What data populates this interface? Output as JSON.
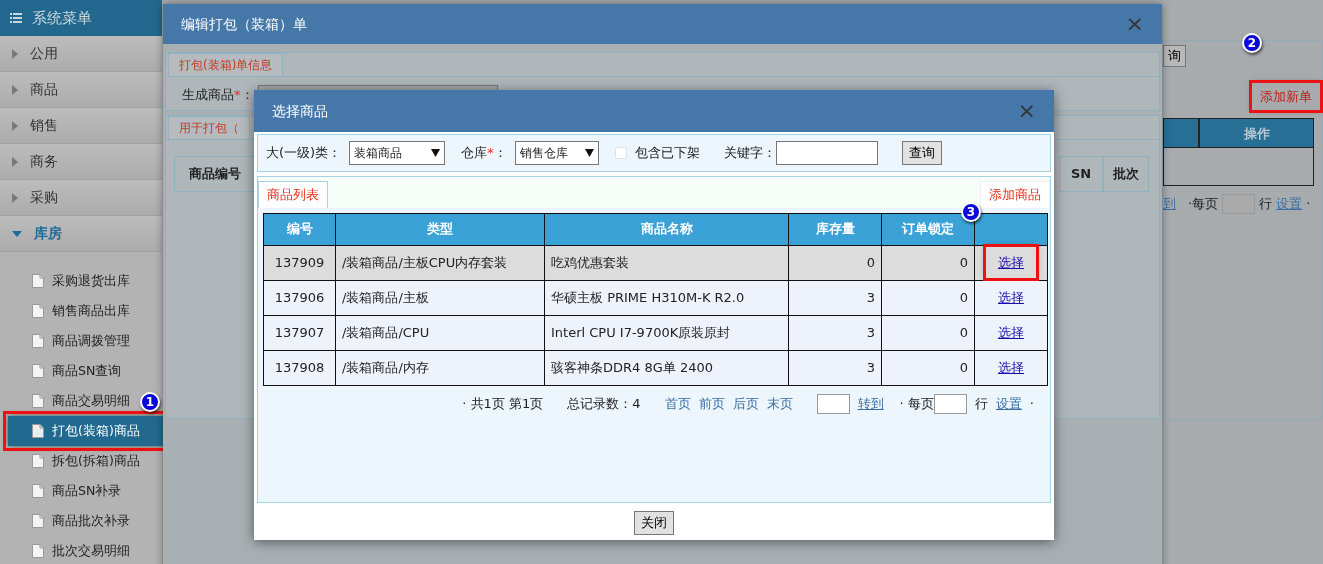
{
  "sidebar": {
    "title": "系统菜单",
    "groups": [
      {
        "label": "公用",
        "expanded": false
      },
      {
        "label": "商品",
        "expanded": false
      },
      {
        "label": "销售",
        "expanded": false
      },
      {
        "label": "商务",
        "expanded": false
      },
      {
        "label": "采购",
        "expanded": false
      },
      {
        "label": "库房",
        "expanded": true,
        "children": [
          {
            "label": "采购退货出库",
            "selected": false
          },
          {
            "label": "销售商品出库",
            "selected": false
          },
          {
            "label": "商品调拨管理",
            "selected": false
          },
          {
            "label": "商品SN查询",
            "selected": false
          },
          {
            "label": "商品交易明细",
            "selected": false
          },
          {
            "label": "打包(装箱)商品",
            "selected": true,
            "callout": "1"
          },
          {
            "label": "拆包(拆箱)商品",
            "selected": false
          },
          {
            "label": "商品SN补录",
            "selected": false
          },
          {
            "label": "商品批次补录",
            "selected": false
          },
          {
            "label": "批次交易明细",
            "selected": false
          }
        ]
      }
    ]
  },
  "background": {
    "search_button": "询",
    "add_link": "添加新单",
    "add_link_callout": "2",
    "columns": [
      "操作"
    ],
    "pager": {
      "goto": "到",
      "per_page": "·每页",
      "rows": "行",
      "settings": "设置",
      "end": "·"
    }
  },
  "edit_dialog": {
    "title": "编辑打包（装箱）单",
    "close_icon": "×",
    "info_tab": "打包(装箱)单信息",
    "product_label": "生成商品",
    "required_mark": "*",
    "colon": "：",
    "items_tab": "用于打包（",
    "columns": [
      "商品编号",
      "SN",
      "批次"
    ]
  },
  "select_dialog": {
    "title": "选择商品",
    "close_icon": "×",
    "filters": {
      "category_label": "大(一级)类：",
      "category": "装箱商品",
      "warehouse_label": "仓库",
      "required_mark": "*",
      "colon": "：",
      "warehouse": "销售仓库",
      "include_delisted": {
        "label": "包含已下架",
        "checked": false
      },
      "keyword_label": "关键字：",
      "search_button": "查询"
    },
    "tabs": [
      {
        "label": "商品列表",
        "selected": true
      }
    ],
    "add_link": "添加商品",
    "table": {
      "columns": [
        "编号",
        "类型",
        "商品名称",
        "库存量",
        "订单锁定"
      ],
      "rows": [
        {
          "cells": [
            "137909",
            "/装箱商品/主板CPU内存套装",
            "吃鸡优惠套装",
            "0",
            "0"
          ],
          "action": "选择",
          "selected": true,
          "callout": "3"
        },
        {
          "cells": [
            "137906",
            "/装箱商品/主板",
            "华硕主板 PRIME H310M-K R2.0",
            "3",
            "0"
          ],
          "action": "选择",
          "selected": false
        },
        {
          "cells": [
            "137907",
            "/装箱商品/CPU",
            "Interl CPU I7-9700K原装原封",
            "3",
            "0"
          ],
          "action": "选择",
          "selected": false
        },
        {
          "cells": [
            "137908",
            "/装箱商品/内存",
            "骇客神条DDR4 8G单 2400",
            "3",
            "0"
          ],
          "action": "选择",
          "selected": false
        }
      ]
    },
    "pager": {
      "summary": "· 共1页 第1页",
      "total": "总记录数：4",
      "links": [
        "首页",
        "前页",
        "后页",
        "末页"
      ],
      "goto": "转到",
      "per_page": "· 每页",
      "rows": "行",
      "settings": "设置",
      "end": "·"
    },
    "close_button": "关闭"
  }
}
